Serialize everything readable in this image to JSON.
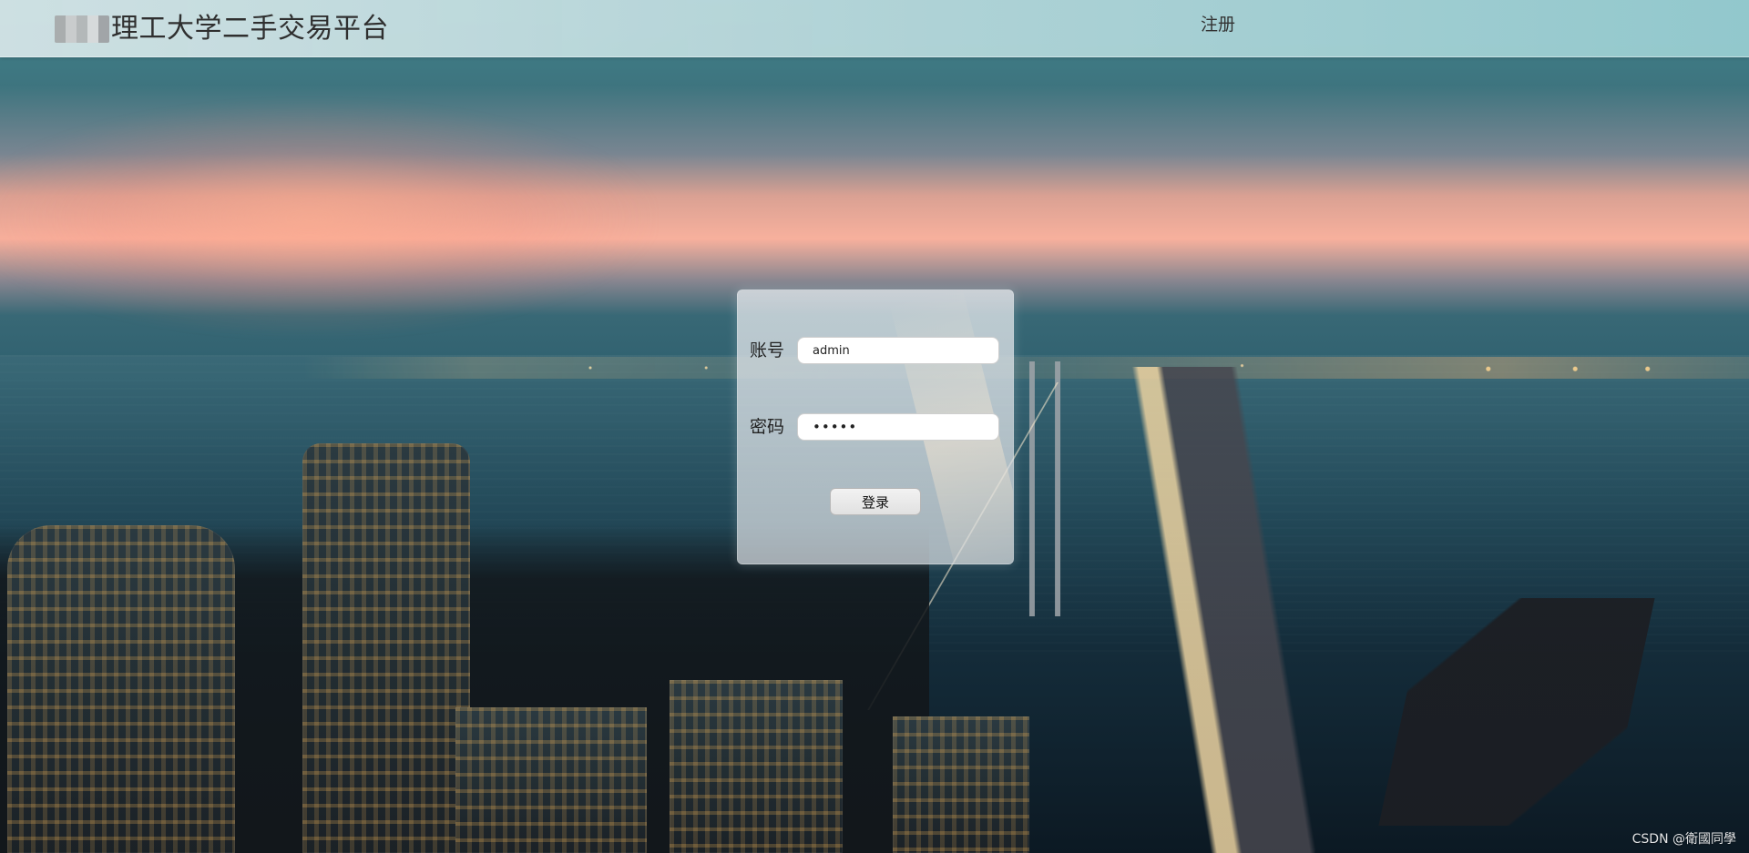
{
  "header": {
    "title": "理工大学二手交易平台",
    "register_label": "注册"
  },
  "login": {
    "account_label": "账号",
    "account_value": "admin",
    "password_label": "密码",
    "password_value": "•••••",
    "submit_label": "登录"
  },
  "footer": {
    "watermark": "CSDN @衛國同學"
  },
  "colors": {
    "topbar": "#bdd8db",
    "card": "#d9dde2",
    "button": "#ececec"
  }
}
